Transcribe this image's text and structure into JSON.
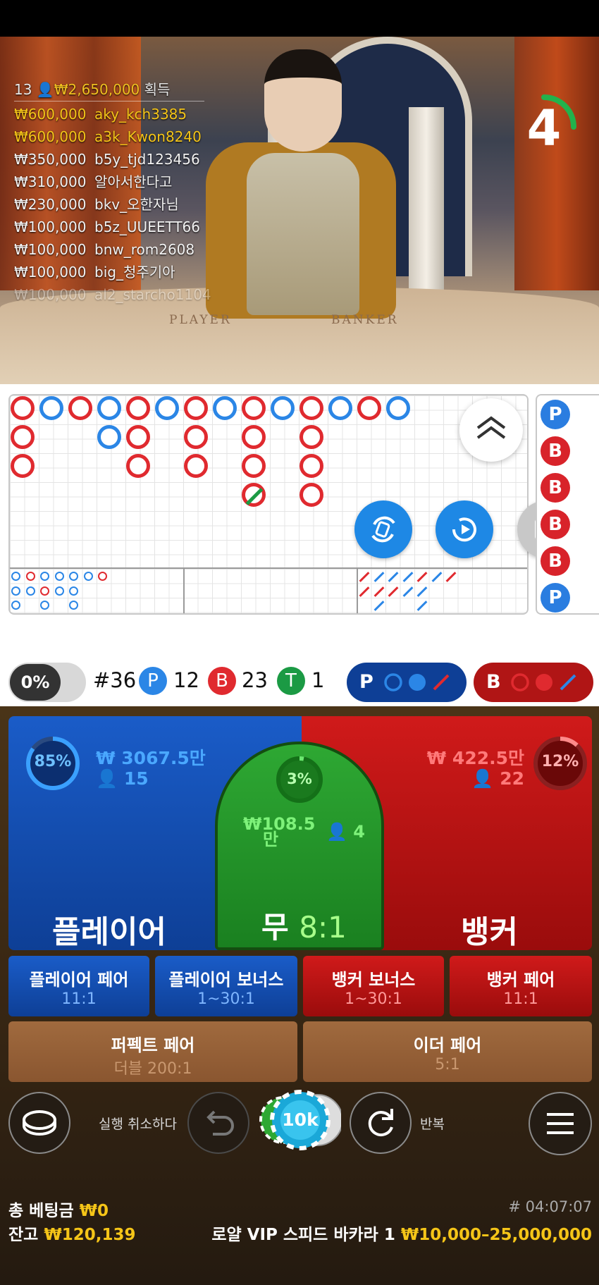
{
  "video": {
    "countdown": "4",
    "felt_player": "PLAYER",
    "felt_banker": "BANKER",
    "winners_header_count": "13",
    "winners_header_amount": "₩2,650,000",
    "winners_header_suffix": "획득",
    "winners": [
      {
        "amount": "₩600,000",
        "name": "aky_kch3385",
        "style": "gold"
      },
      {
        "amount": "₩600,000",
        "name": "a3k_Kwon8240",
        "style": "gold"
      },
      {
        "amount": "₩350,000",
        "name": "b5y_tjd123456",
        "style": "white"
      },
      {
        "amount": "₩310,000",
        "name": "알아서한다고",
        "style": "white"
      },
      {
        "amount": "₩230,000",
        "name": "bkv_오한자님",
        "style": "white"
      },
      {
        "amount": "₩100,000",
        "name": "b5z_UUEETT66",
        "style": "white"
      },
      {
        "amount": "₩100,000",
        "name": "bnw_rom2608",
        "style": "white"
      },
      {
        "amount": "₩100,000",
        "name": "big_청주기아",
        "style": "white"
      },
      {
        "amount": "₩100,000",
        "name": "al2_starcho1104",
        "style": "fade"
      }
    ]
  },
  "roadmap": {
    "bead_road": [
      "P",
      "B",
      "B",
      "B",
      "B",
      "P"
    ],
    "colors": {
      "player": "#2b86e6",
      "banker": "#e02a2f",
      "tie": "#1b9a44"
    }
  },
  "stats": {
    "percent": "0%",
    "round": "#36",
    "player_label": "P",
    "player_count": "12",
    "banker_label": "B",
    "banker_count": "23",
    "tie_label": "T",
    "tie_count": "1",
    "player_ask": "P",
    "banker_ask": "B"
  },
  "bets": {
    "player": {
      "label": "플레이어",
      "percent": "85%",
      "amount": "₩ 3067.5만",
      "players": "15"
    },
    "tie": {
      "label": "무",
      "odds": "8:1",
      "percent": "3%",
      "amount": "₩108.5",
      "amount_unit": "만",
      "players": "4"
    },
    "banker": {
      "label": "뱅커",
      "percent": "12%",
      "amount": "₩ 422.5만",
      "players": "22"
    },
    "side": [
      {
        "label": "플레이어 페어",
        "odds": "11:1"
      },
      {
        "label": "플레이어 보너스",
        "odds": "1~30:1"
      },
      {
        "label": "뱅커 보너스",
        "odds": "1~30:1"
      },
      {
        "label": "뱅커 페어",
        "odds": "11:1"
      },
      {
        "label": "퍼펙트 페어",
        "odds": "더블 200:1"
      },
      {
        "label": "이더 페어",
        "odds": "5:1"
      }
    ]
  },
  "controls": {
    "undo_label": "실행 취소하다",
    "repeat_label": "반복",
    "chip_value": "10k"
  },
  "footer": {
    "total_bet_label": "총 베팅금",
    "total_bet_value": "₩0",
    "balance_label": "잔고",
    "balance_value": "₩120,139",
    "game_id": "# 04:07:07",
    "table_name": "로얄 VIP 스피드 바카라 1",
    "table_limits": "₩10,000–25,000,000"
  }
}
